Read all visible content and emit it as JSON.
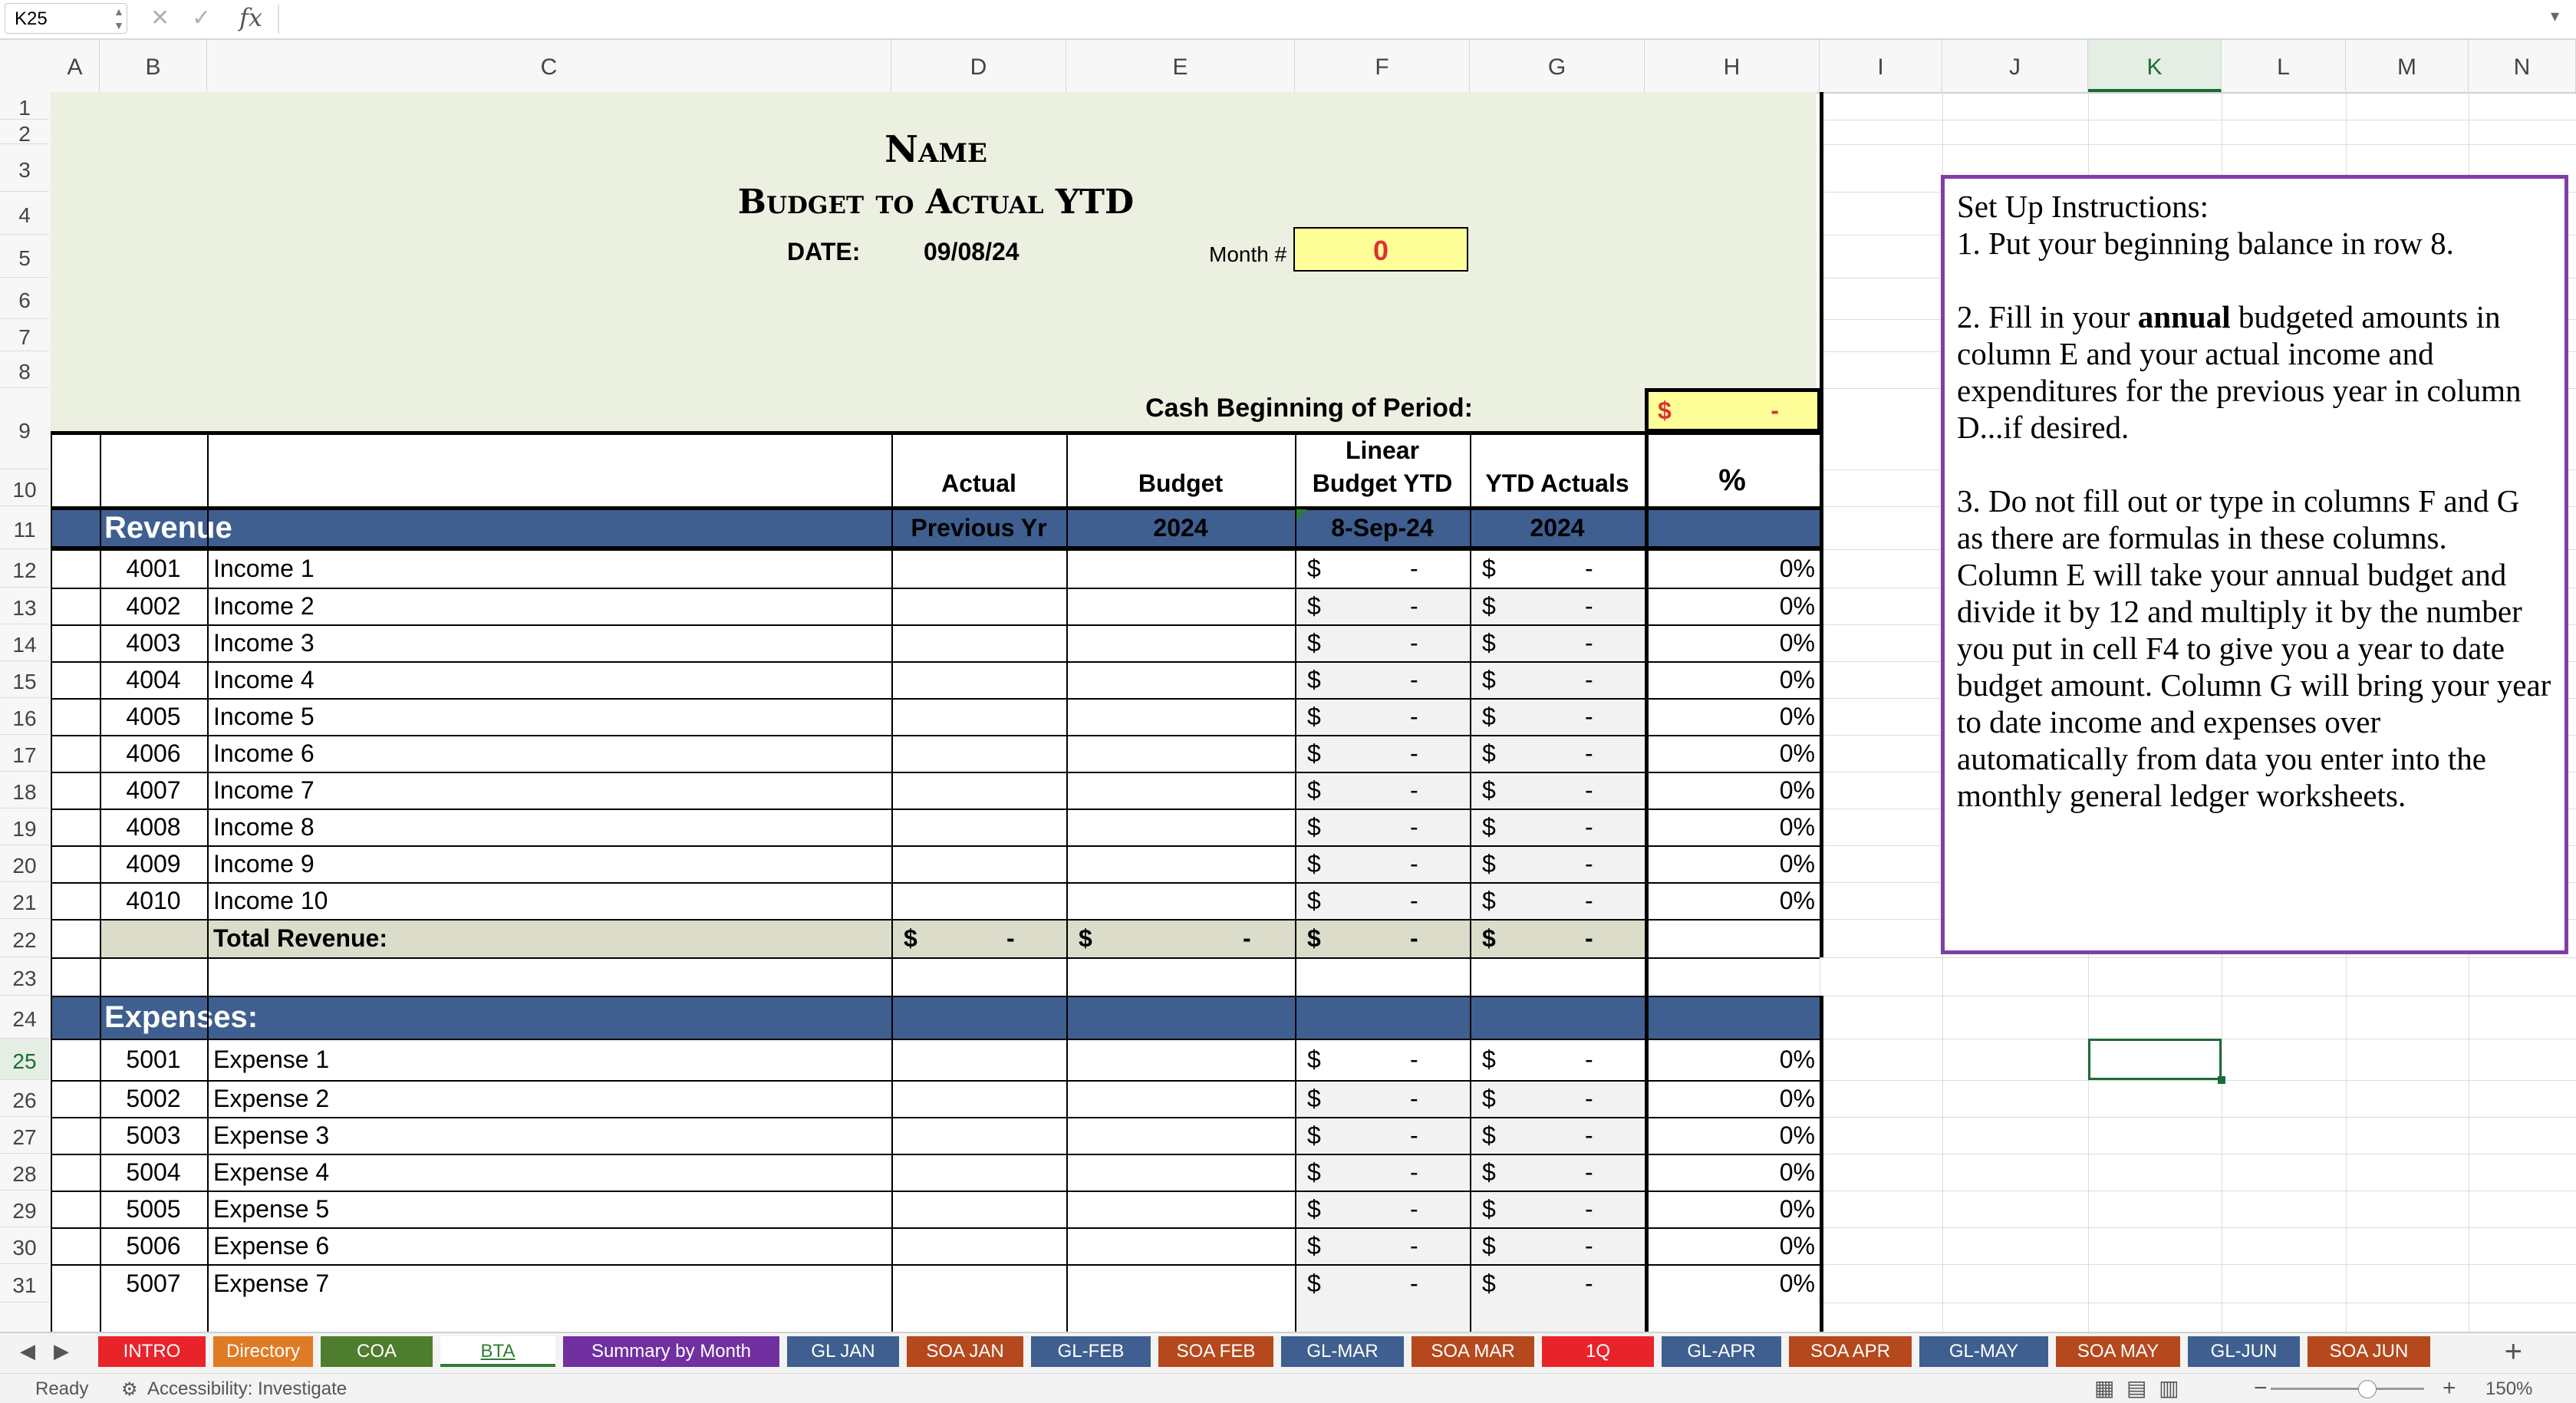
{
  "formula_bar": {
    "name_box": "K25",
    "fx_label": "fx",
    "formula": ""
  },
  "columns": [
    "A",
    "B",
    "C",
    "D",
    "E",
    "F",
    "G",
    "H",
    "I",
    "J",
    "K",
    "L",
    "M",
    "N"
  ],
  "rows": [
    "1",
    "2",
    "3",
    "4",
    "5",
    "6",
    "7",
    "8",
    "9",
    "10",
    "11",
    "12",
    "13",
    "14",
    "15",
    "16",
    "17",
    "18",
    "19",
    "20",
    "21",
    "22",
    "23",
    "24",
    "25",
    "26",
    "27",
    "28",
    "29",
    "30",
    "31"
  ],
  "selected_cell": "K25",
  "sheet": {
    "name": "Name",
    "title": "Budget to Actual YTD",
    "date_label": "DATE:",
    "date_value": "09/08/24",
    "month_label": "Month #",
    "month_value": "0",
    "cash_label": "Cash Beginning of Period:",
    "cash_currency": "$",
    "cash_value": "-",
    "headers": {
      "actual": "Actual",
      "actual_sub": "Previous Yr",
      "budget": "Budget",
      "budget_sub": "2024",
      "linear_1": "Linear",
      "linear_2": "Budget YTD",
      "linear_sub": "8-Sep-24",
      "ytd": "YTD Actuals",
      "ytd_sub": "2024",
      "pct": "%"
    },
    "revenue_label": "Revenue",
    "revenue_rows": [
      {
        "code": "4001",
        "name": "Income 1",
        "pct": "0%"
      },
      {
        "code": "4002",
        "name": "Income 2",
        "pct": "0%"
      },
      {
        "code": "4003",
        "name": "Income 3",
        "pct": "0%"
      },
      {
        "code": "4004",
        "name": "Income 4",
        "pct": "0%"
      },
      {
        "code": "4005",
        "name": "Income 5",
        "pct": "0%"
      },
      {
        "code": "4006",
        "name": "Income 6",
        "pct": "0%"
      },
      {
        "code": "4007",
        "name": "Income 7",
        "pct": "0%"
      },
      {
        "code": "4008",
        "name": "Income 8",
        "pct": "0%"
      },
      {
        "code": "4009",
        "name": "Income 9",
        "pct": "0%"
      },
      {
        "code": "4010",
        "name": "Income 10",
        "pct": "0%"
      }
    ],
    "total_revenue_label": "Total Revenue:",
    "currency": "$",
    "dash": "-",
    "expenses_label": "Expenses:",
    "expense_rows": [
      {
        "code": "5001",
        "name": "Expense 1",
        "pct": "0%"
      },
      {
        "code": "5002",
        "name": "Expense 2",
        "pct": "0%"
      },
      {
        "code": "5003",
        "name": "Expense 3",
        "pct": "0%"
      },
      {
        "code": "5004",
        "name": "Expense 4",
        "pct": "0%"
      },
      {
        "code": "5005",
        "name": "Expense 5",
        "pct": "0%"
      },
      {
        "code": "5006",
        "name": "Expense 6",
        "pct": "0%"
      },
      {
        "code": "5007",
        "name": "Expense 7",
        "pct": "0%"
      }
    ]
  },
  "instructions": {
    "title": "Set Up Instructions:",
    "step1": "1. Put your beginning balance in row 8.",
    "step2_pre": "2. Fill in your ",
    "step2_bold": "annual",
    "step2_post": " budgeted amounts in column E and your actual income and expenditures for the  previous year in column D...if desired.",
    "step3": "3. Do not fill out or type in columns F and G as there are formulas in these columns. Column E will take your annual budget and divide it by 12 and multiply it by the number you put in cell F4 to give you a year to date budget amount. Column G will bring your year to date income and expenses over automatically from data you enter into the monthly general ledger worksheets."
  },
  "tabs": [
    {
      "label": "INTRO",
      "color": "#e8242a"
    },
    {
      "label": "Directory",
      "color": "#e07b25"
    },
    {
      "label": "COA",
      "color": "#4e7d2d"
    },
    {
      "label": "BTA",
      "color": "#ffffff",
      "active": true
    },
    {
      "label": "Summary by Month",
      "color": "#7030a0"
    },
    {
      "label": "GL JAN",
      "color": "#3e5f8f"
    },
    {
      "label": "SOA JAN",
      "color": "#b5491d"
    },
    {
      "label": "GL-FEB",
      "color": "#3e5f8f"
    },
    {
      "label": "SOA FEB",
      "color": "#b5491d"
    },
    {
      "label": "GL-MAR",
      "color": "#3e5f8f"
    },
    {
      "label": "SOA MAR",
      "color": "#b5491d"
    },
    {
      "label": "1Q",
      "color": "#e8242a"
    },
    {
      "label": "GL-APR",
      "color": "#3e5f8f"
    },
    {
      "label": "SOA APR",
      "color": "#b5491d"
    },
    {
      "label": "GL-MAY",
      "color": "#3e5f8f"
    },
    {
      "label": "SOA MAY",
      "color": "#b5491d"
    },
    {
      "label": "GL-JUN",
      "color": "#3e5f8f"
    },
    {
      "label": "SOA JUN",
      "color": "#b5491d"
    }
  ],
  "status": {
    "ready": "Ready",
    "accessibility": "Accessibility: Investigate",
    "zoom": "150%"
  }
}
